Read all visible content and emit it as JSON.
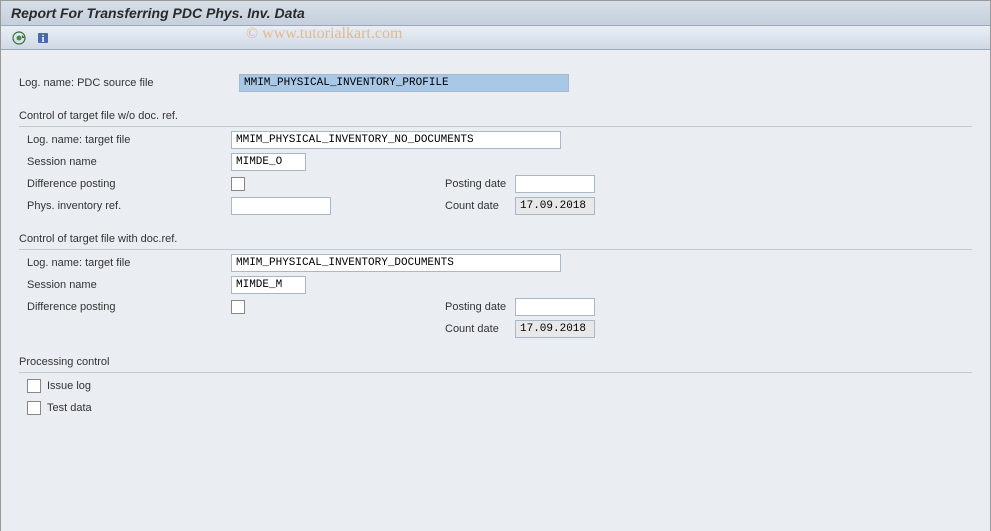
{
  "title": "Report For Transferring PDC Phys. Inv. Data",
  "watermark": "© www.tutorialkart.com",
  "source": {
    "label": "Log. name: PDC source file",
    "value": "MMIM_PHYSICAL_INVENTORY_PROFILE"
  },
  "group1": {
    "title": "Control of target file w/o doc. ref.",
    "target_label": "Log. name: target file",
    "target_value": "MMIM_PHYSICAL_INVENTORY_NO_DOCUMENTS",
    "session_label": "Session name",
    "session_value": "MIMDE_O",
    "diff_label": "Difference posting",
    "phys_label": "Phys. inventory ref.",
    "phys_value": "",
    "posting_label": "Posting date",
    "posting_value": "",
    "count_label": "Count date",
    "count_value": "17.09.2018"
  },
  "group2": {
    "title": "Control of target file with doc.ref.",
    "target_label": "Log. name: target file",
    "target_value": "MMIM_PHYSICAL_INVENTORY_DOCUMENTS",
    "session_label": "Session name",
    "session_value": "MIMDE_M",
    "diff_label": "Difference posting",
    "posting_label": "Posting date",
    "posting_value": "",
    "count_label": "Count date",
    "count_value": "17.09.2018"
  },
  "group3": {
    "title": "Processing control",
    "issue_label": "Issue log",
    "test_label": "Test data"
  }
}
